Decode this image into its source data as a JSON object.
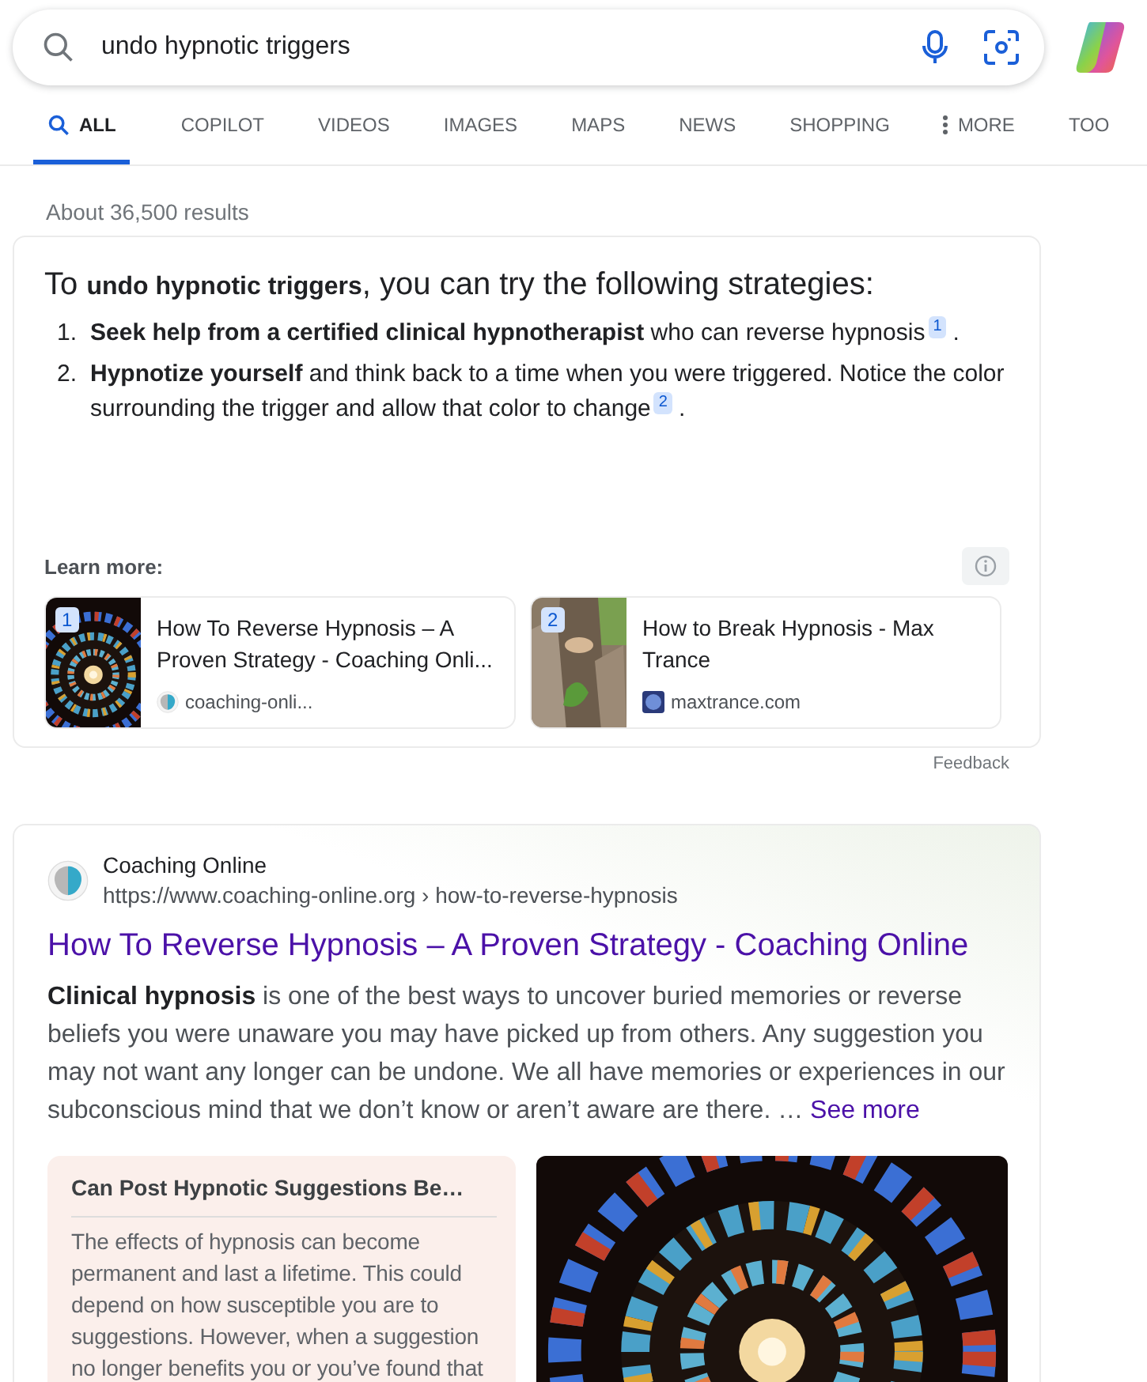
{
  "search": {
    "value": "undo hypnotic triggers"
  },
  "tabs": [
    {
      "label": "ALL",
      "selected": true,
      "kind": "search"
    },
    {
      "label": "COPILOT",
      "selected": false,
      "kind": "plain"
    },
    {
      "label": "VIDEOS",
      "selected": false,
      "kind": "plain"
    },
    {
      "label": "IMAGES",
      "selected": false,
      "kind": "plain"
    },
    {
      "label": "MAPS",
      "selected": false,
      "kind": "plain"
    },
    {
      "label": "NEWS",
      "selected": false,
      "kind": "plain"
    },
    {
      "label": "SHOPPING",
      "selected": false,
      "kind": "plain"
    },
    {
      "label": "MORE",
      "selected": false,
      "kind": "more"
    },
    {
      "label": "TOO",
      "selected": false,
      "kind": "plain"
    }
  ],
  "result_count": "About 36,500 results",
  "answer": {
    "intro": "To **undo hypnotic triggers**, you can try the following strategies:",
    "items": [
      {
        "number": "1.",
        "text": "**Seek help from a certified clinical hypnotherapist** who can reverse hypnosis",
        "citation": "1",
        "end": "."
      },
      {
        "number": "2.",
        "text": "**Hypnotize yourself** and think back to a time when you were triggered. Notice the color surrounding the trigger and allow that color to change",
        "citation": "2",
        "end": "."
      }
    ],
    "learn_more": "Learn more:",
    "sources": [
      {
        "badge": "1",
        "title": "How To Reverse Hypnosis – A Proven Strategy - Coaching Onli...",
        "site": "coaching-onli..."
      },
      {
        "badge": "2",
        "title": "How to Break Hypnosis - Max Trance",
        "site": "maxtrance.com"
      }
    ],
    "feedback": "Feedback"
  },
  "result": {
    "site": "Coaching Online",
    "url": "https://www.coaching-online.org › how-to-reverse-hypnosis",
    "title": "How To Reverse Hypnosis – A Proven Strategy - Coaching Online",
    "snippet": "**Clinical hypnosis** is one of the best ways to uncover buried memories or reverse beliefs you were unaware you may have picked up from others. Any suggestion you may not want any longer can be undone. We all have memories or experiences in our subconscious mind that we don’t know or aren’t aware are there. …",
    "see_more": "See more",
    "faq": {
      "question": "Can Post Hypnotic Suggestions Be…",
      "answer": "The effects of hypnosis can become permanent and last a lifetime. This could depend on how susceptible you are to suggestions. However, when a suggestion no longer benefits you or you’ve found that"
    }
  }
}
